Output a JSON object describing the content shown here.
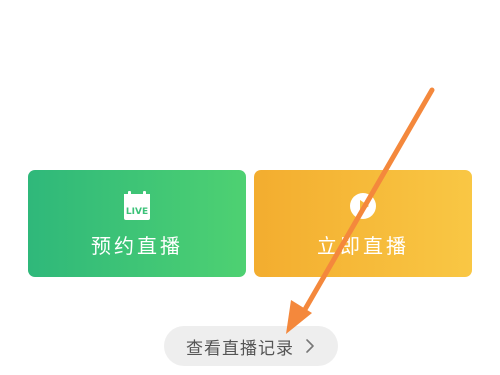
{
  "cards": {
    "schedule": {
      "label": "预约直播",
      "icon": "calendar-live-icon",
      "icon_text": "LIVE",
      "gradient_start": "#2fb87a",
      "gradient_end": "#4ed172"
    },
    "start": {
      "label": "立即直播",
      "icon": "live-start-icon",
      "gradient_start": "#f3ad2f",
      "gradient_end": "#f9c744"
    }
  },
  "history": {
    "label": "查看直播记录",
    "chevron_icon": "chevron-right-icon"
  },
  "annotation": {
    "icon": "pointer-arrow",
    "color": "#f4883c"
  }
}
